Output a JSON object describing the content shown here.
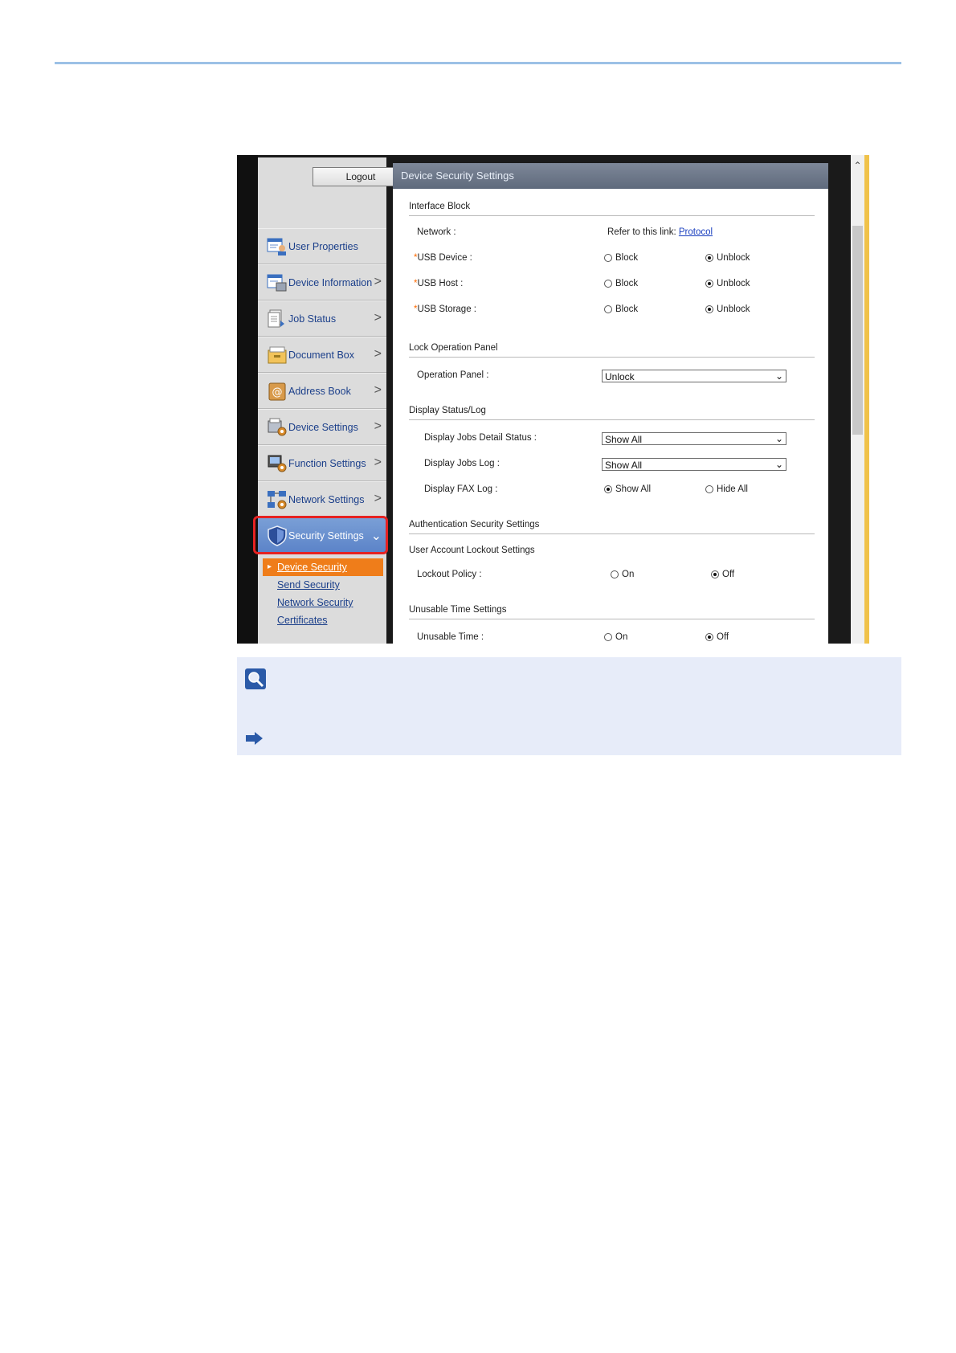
{
  "sidebar": {
    "logout_label": "Logout",
    "items": [
      {
        "label": "User Properties",
        "icon": "user-properties-icon",
        "chevron": false
      },
      {
        "label": "Device Information",
        "icon": "device-information-icon",
        "chevron": true
      },
      {
        "label": "Job Status",
        "icon": "job-status-icon",
        "chevron": true
      },
      {
        "label": "Document Box",
        "icon": "document-box-icon",
        "chevron": true
      },
      {
        "label": "Address Book",
        "icon": "address-book-icon",
        "chevron": true
      },
      {
        "label": "Device Settings",
        "icon": "device-settings-icon",
        "chevron": true
      },
      {
        "label": "Function Settings",
        "icon": "function-settings-icon",
        "chevron": true
      },
      {
        "label": "Network Settings",
        "icon": "network-settings-icon",
        "chevron": true
      },
      {
        "label": "Security Settings",
        "icon": "shield-icon",
        "chevron": true,
        "active": true
      }
    ],
    "subitems": [
      {
        "label": "Device Security",
        "selected": true
      },
      {
        "label": "Send Security"
      },
      {
        "label": "Network Security"
      },
      {
        "label": "Certificates"
      }
    ]
  },
  "content": {
    "title": "Device Security Settings",
    "interface_block": {
      "heading": "Interface Block",
      "network_label": "Network :",
      "network_ref": "Refer to this link:",
      "network_link": "Protocol",
      "usb_device_label": "USB Device :",
      "usb_host_label": "USB Host :",
      "usb_storage_label": "USB Storage :",
      "block": "Block",
      "unblock": "Unblock"
    },
    "lock_operation_panel": {
      "heading": "Lock Operation Panel",
      "label": "Operation Panel :",
      "value": "Unlock"
    },
    "display_status_log": {
      "heading": "Display Status/Log",
      "jobs_detail_label": "Display Jobs Detail Status :",
      "jobs_detail_value": "Show All",
      "jobs_log_label": "Display Jobs Log :",
      "jobs_log_value": "Show All",
      "fax_log_label": "Display FAX Log :",
      "show_all": "Show All",
      "hide_all": "Hide All"
    },
    "auth_security": {
      "heading": "Authentication Security Settings",
      "lockout_heading": "User Account Lockout Settings",
      "lockout_policy_label": "Lockout Policy :",
      "unusable_heading": "Unusable Time Settings",
      "unusable_time_label": "Unusable Time :",
      "on": "On",
      "off": "Off"
    },
    "required_mark": "*"
  },
  "colors": {
    "accent_rule": "#9cc1e6",
    "active_nav": "#5b83c8",
    "selected_sub": "#ef7d1a",
    "highlight": "#e52222",
    "note_bg": "#e7ecf9"
  }
}
